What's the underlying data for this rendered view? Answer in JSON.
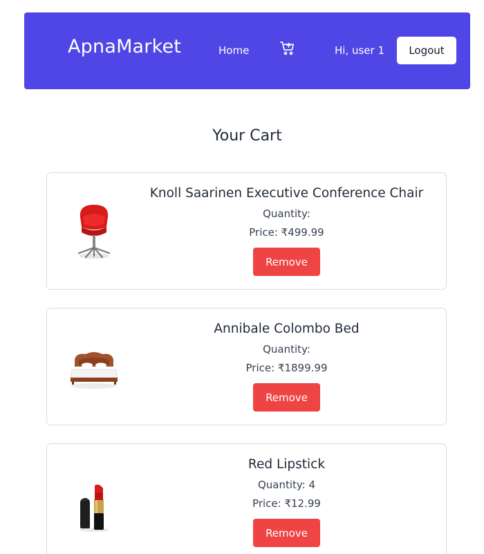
{
  "navbar": {
    "brand": "ApnaMarket",
    "home_label": "Home",
    "cart_icon": "cart-plus-icon",
    "greeting": "Hi, user 1",
    "logout_label": "Logout",
    "background_color": "#4f46e5"
  },
  "cart": {
    "title": "Your Cart",
    "quantity_prefix": "Quantity:",
    "price_prefix": "Price:",
    "remove_label": "Remove",
    "remove_color": "#ef4444",
    "items": [
      {
        "name": "Knoll Saarinen Executive Conference Chair",
        "quantity": "",
        "quantity_text": "Quantity:",
        "price_text": "Price: ₹499.99",
        "image": "red-office-chair"
      },
      {
        "name": "Annibale Colombo Bed",
        "quantity": "",
        "quantity_text": "Quantity:",
        "price_text": "Price: ₹1899.99",
        "image": "wooden-bed"
      },
      {
        "name": "Red Lipstick",
        "quantity": "4",
        "quantity_text": "Quantity: 4",
        "price_text": "Price: ₹12.99",
        "image": "red-lipstick"
      }
    ]
  }
}
